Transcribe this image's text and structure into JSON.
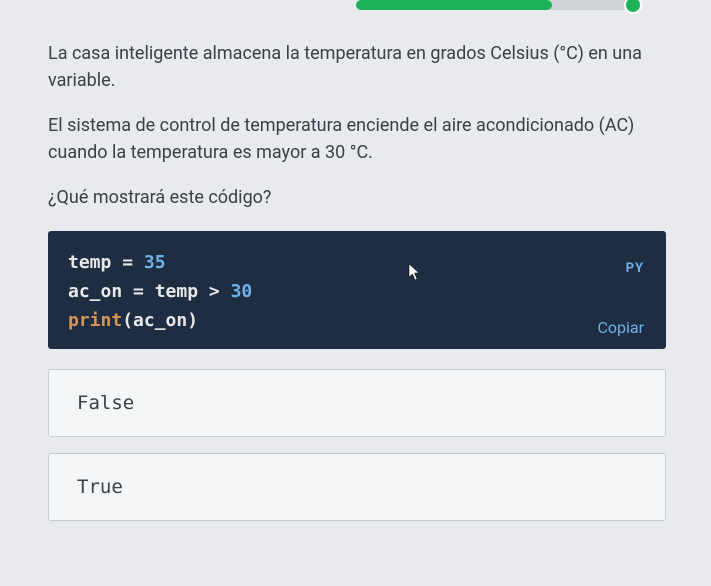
{
  "progress": {
    "percent": 70
  },
  "question": {
    "paragraph1": "La casa inteligente almacena la temperatura en grados Celsius (°C) en una variable.",
    "paragraph2": "El sistema de control de temperatura enciende el aire acondicionado (AC) cuando la temperatura es mayor a 30 °C.",
    "paragraph3": "¿Qué mostrará este código?"
  },
  "code": {
    "lang_badge": "PY",
    "copy_label": "Copiar",
    "tokens": {
      "line1_var": "temp",
      "line1_eq": " = ",
      "line1_num": "35",
      "line2_var": "ac_on",
      "line2_eq": " = ",
      "line2_var2": "temp",
      "line2_gt": " > ",
      "line2_num": "30",
      "line3_func": "print",
      "line3_open": "(",
      "line3_arg": "ac_on",
      "line3_close": ")"
    }
  },
  "answers": {
    "option1": "False",
    "option2": "True"
  }
}
